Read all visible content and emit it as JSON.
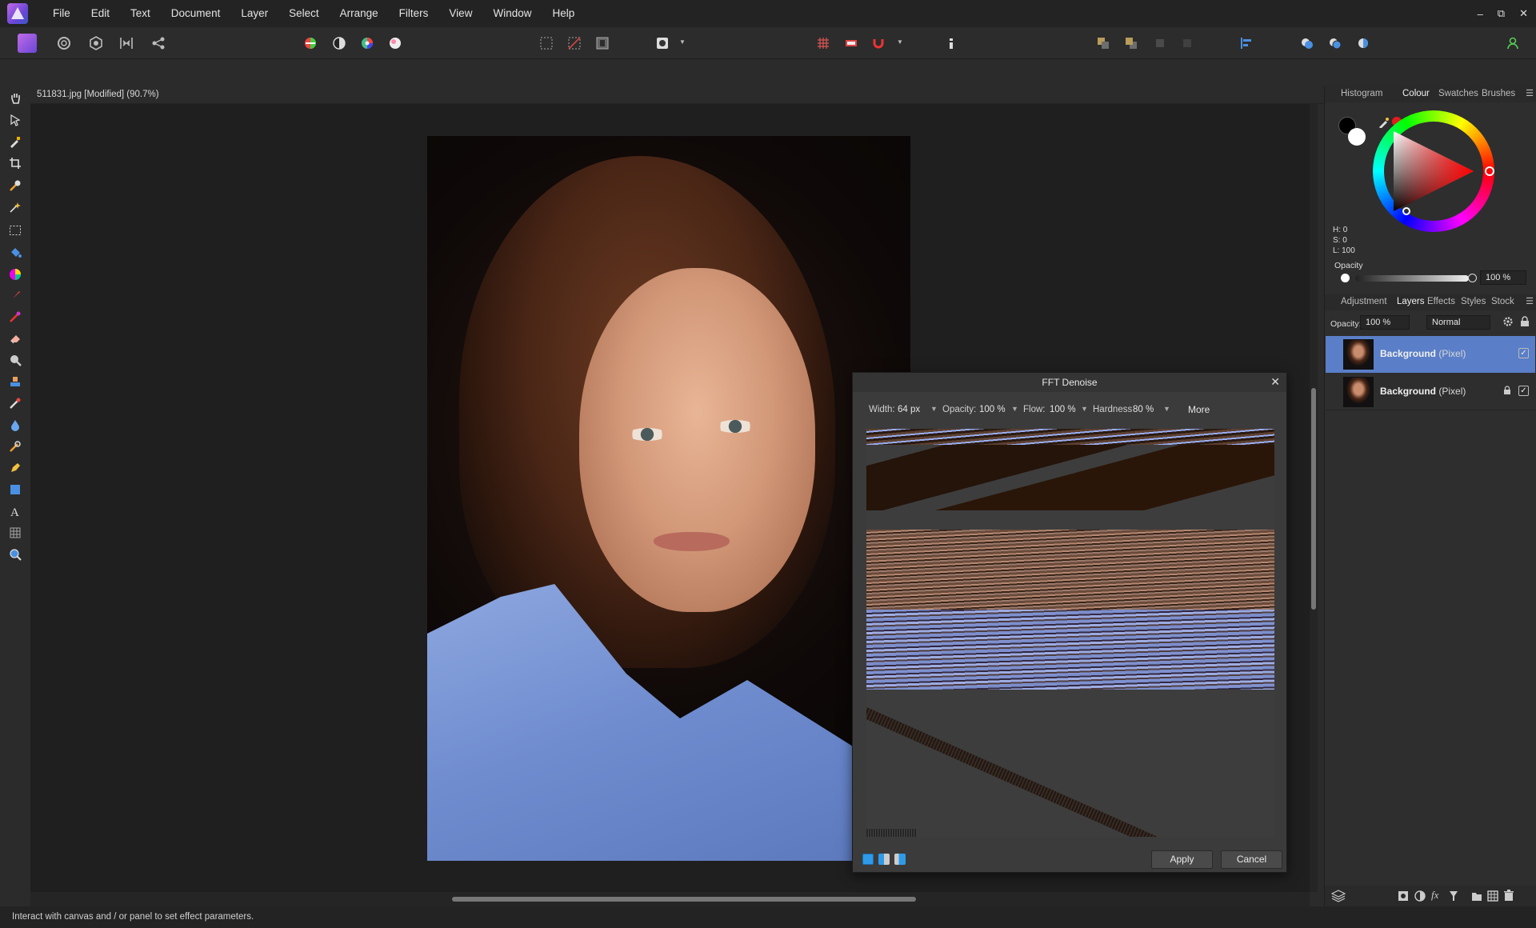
{
  "menu": [
    "File",
    "Edit",
    "Text",
    "Document",
    "Layer",
    "Select",
    "Arrange",
    "Filters",
    "View",
    "Window",
    "Help"
  ],
  "window_controls": {
    "minimize": "–",
    "restore": "⧉",
    "close": "✕"
  },
  "document": {
    "title": "511831.jpg [Modified] (90.7%)",
    "close": "×"
  },
  "fft_dialog": {
    "title": "FFT Denoise",
    "close": "✕",
    "width_label": "Width:",
    "width_value": "64 px",
    "opacity_label": "Opacity:",
    "opacity_value": "100 %",
    "flow_label": "Flow:",
    "flow_value": "100 %",
    "hardness_label": "Hardness",
    "hardness_value": "80 %",
    "more_label": "More",
    "apply_label": "Apply",
    "cancel_label": "Cancel"
  },
  "colour_panel": {
    "tabs": [
      "Histogram",
      "Colour",
      "Swatches",
      "Brushes"
    ],
    "active_tab": "Colour",
    "h": "H: 0",
    "s": "S: 0",
    "l": "L: 100",
    "opacity_label": "Opacity",
    "opacity_value": "100 %",
    "foreground": "#000000",
    "background": "#ffffff"
  },
  "layers_panel": {
    "tabs": [
      "Adjustment",
      "Layers",
      "Effects",
      "Styles",
      "Stock"
    ],
    "active_tab": "Layers",
    "opacity_label": "Opacity:",
    "opacity_value": "100 %",
    "blend_mode": "Normal",
    "layers": [
      {
        "name": "Background",
        "type": "(Pixel)",
        "selected": true,
        "locked": false,
        "visible": true
      },
      {
        "name": "Background",
        "type": "(Pixel)",
        "selected": false,
        "locked": true,
        "visible": true
      }
    ]
  },
  "status": "Interact with canvas and / or panel to set effect parameters.",
  "colors": {
    "accent": "#6a8fd8",
    "selected_layer": "#5a7ec7",
    "panel_bg": "#2e2e2e",
    "canvas_bg": "#1f1f1f"
  }
}
